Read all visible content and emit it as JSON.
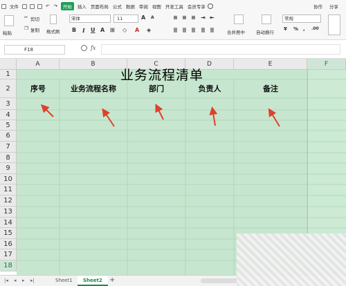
{
  "menubar": {
    "file_label": "文件",
    "start_label": "开始",
    "tabs": [
      "插入",
      "页面布局",
      "公式",
      "数据",
      "审阅",
      "视图",
      "开发工具",
      "会员专享"
    ],
    "collab_label": "协作",
    "share_label": "分享"
  },
  "toolbar": {
    "paste_label": "粘贴",
    "cut_label": "剪切",
    "copy_label": "复制",
    "format_painter_label": "格式刷",
    "font_name": "宋体",
    "font_size": "11",
    "merge_center_label": "合并居中",
    "wrap_label": "自动换行",
    "number_format": "常规",
    "currency_symbol": "¥",
    "percent_symbol": "%"
  },
  "formula_bar": {
    "cell_ref": "F18",
    "fx_label": "fx",
    "value": ""
  },
  "columns": [
    "A",
    "B",
    "C",
    "D",
    "E",
    "F"
  ],
  "rows": [
    "1",
    "2",
    "3",
    "4",
    "5",
    "6",
    "7",
    "8",
    "9",
    "10",
    "11",
    "12",
    "13",
    "14",
    "15",
    "16",
    "17",
    "18"
  ],
  "selected": {
    "column": "F",
    "row": "18"
  },
  "sheet": {
    "title": "业务流程清单",
    "headers": [
      "序号",
      "业务流程名称",
      "部门",
      "负责人",
      "备注"
    ]
  },
  "annotation_color": "#e0402a",
  "cell_background": "#c7e6cf",
  "sheet_tabs": [
    "Sheet1",
    "Sheet2"
  ],
  "active_sheet": "Sheet2"
}
